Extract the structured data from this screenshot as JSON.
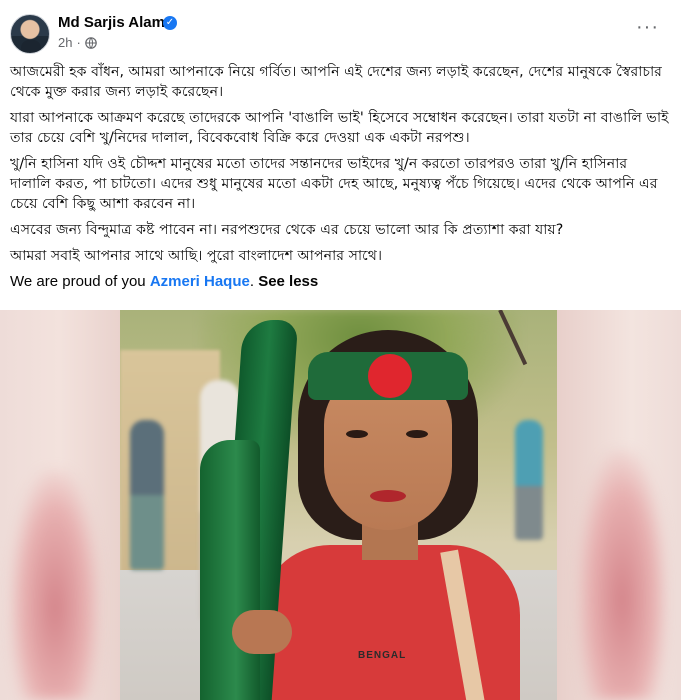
{
  "post": {
    "author": "Md Sarjis Alam",
    "verified_mark": "✓",
    "time": "2h",
    "dot": "·",
    "audience_icon": "globe-icon",
    "more_label": "···",
    "paragraphs": [
      "আজমেরী হক বাঁধন, আমরা আপনাকে নিয়ে গর্বিত। আপনি এই দেশের জন্য লড়াই করেছেন, দেশের মানুষকে স্বৈরাচার থেকে মুক্ত করার জন্য লড়াই করেছেন।",
      "যারা আপনাকে আক্রমণ করেছে তাদেরকে আপনি 'বাঙালি ভাই' হিসেবে সম্বোধন করেছেন। তারা যতটা না বাঙালি ভাই তার চেয়ে বেশি খু/নিদের দালাল, বিবেকবোধ বিক্রি করে দেওয়া এক একটা নরপশু।",
      "খু/নি হাসিনা যদি ওই চৌদ্দশ মানুষের মতো তাদের সন্তানদের ভাইদের খু/ন করতো  তারপরও তারা খু/নি হাসিনার দালালি করত, পা চাটতো। এদের শুধু মানুষের মতো একটা দেহ আছে, মনুষ্যত্ব পঁচে গিয়েছে। এদের থেকে আপনি এর চেয়ে বেশি কিছু আশা করবেন না।",
      "এসবের জন্য বিন্দুমাত্র কষ্ট পাবেন না। নরপশুদের থেকে এর চেয়ে ভালো আর কি প্রত্যাশা করা যায়?",
      "আমরা সবাই আপনার সাথে আছি। পুরো বাংলাদেশ আপনার সাথে।"
    ],
    "english_prefix": "We are proud of you ",
    "mention": "Azmeri Haque",
    "english_sep": ". ",
    "see_less": "See less"
  },
  "photo": {
    "shirt_text": "BENGAL"
  },
  "colors": {
    "link": "#1877f2",
    "secondary_text": "#65676b",
    "flag_green": "#1f6b3a",
    "flag_red": "#e0262e"
  }
}
